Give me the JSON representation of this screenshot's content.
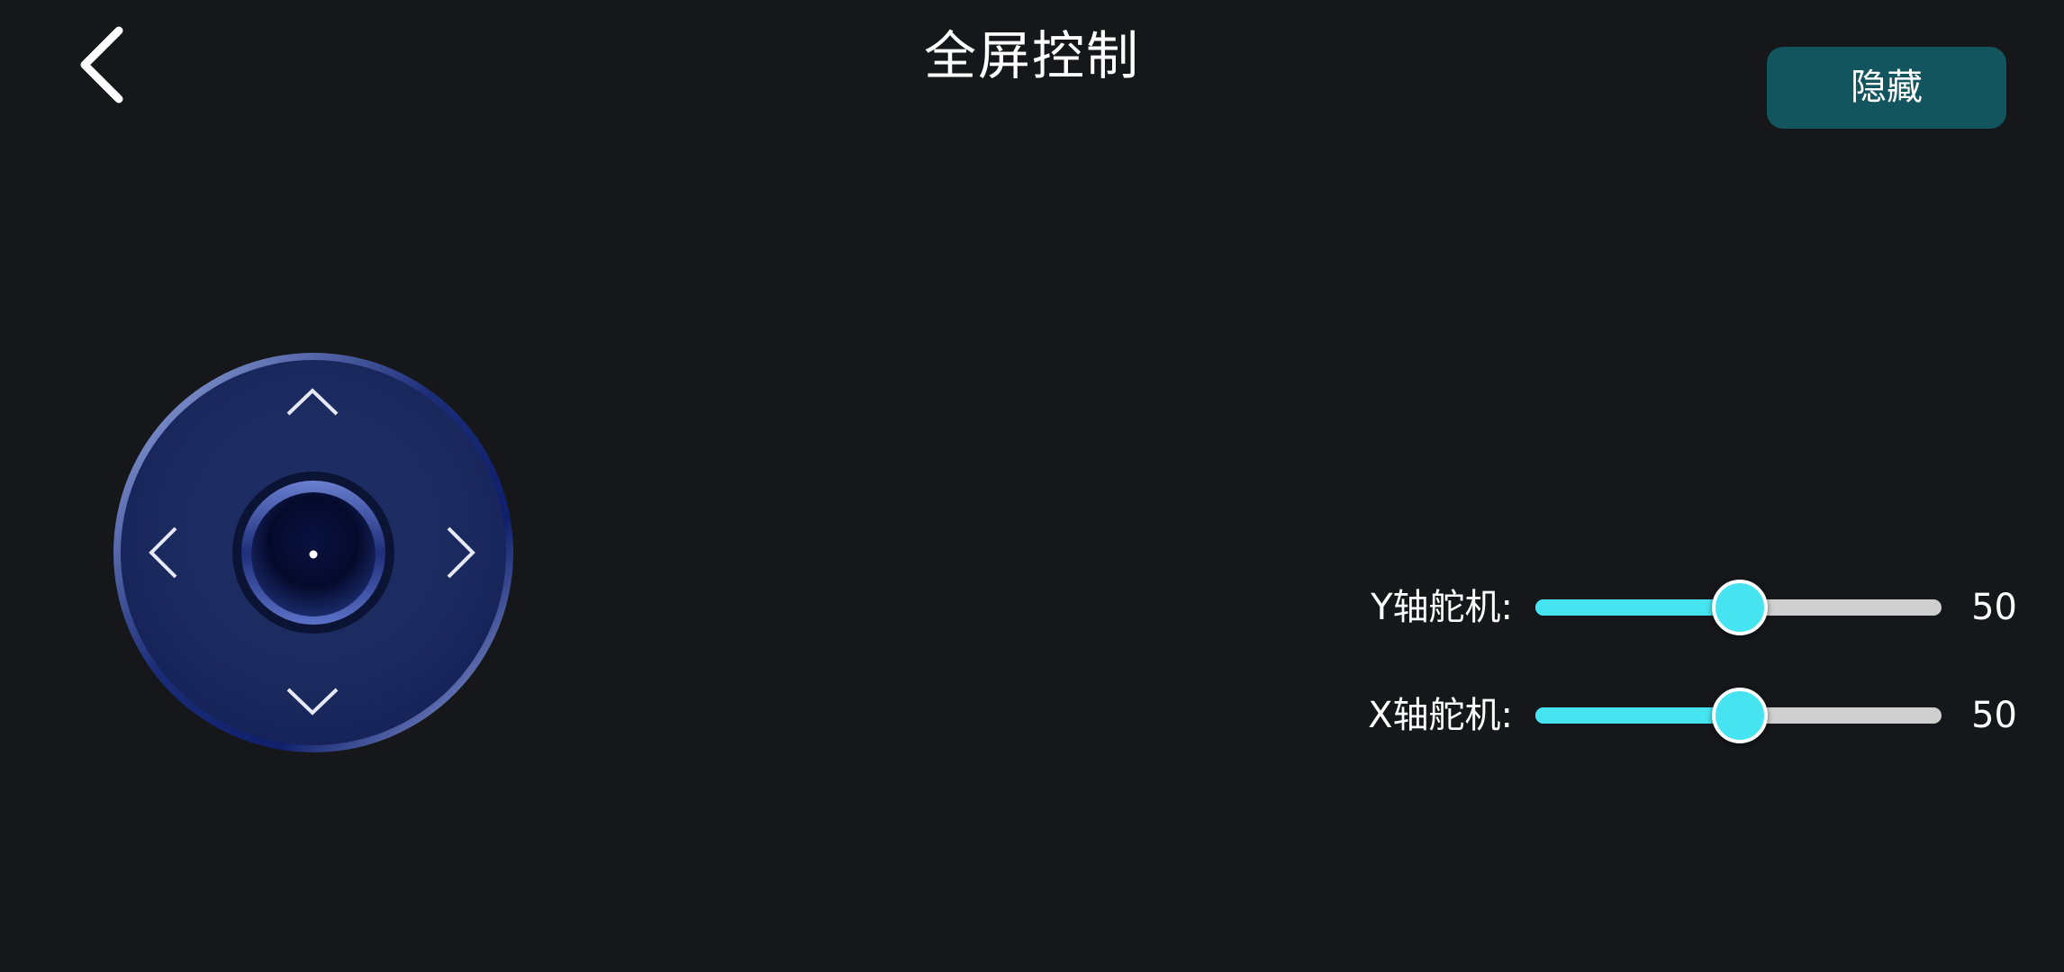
{
  "header": {
    "back_icon": "chevron-left-icon",
    "title": "全屏控制",
    "hide_button_label": "隐藏"
  },
  "joystick": {
    "up_icon": "chevron-up-icon",
    "down_icon": "chevron-down-icon",
    "left_icon": "chevron-left-icon",
    "right_icon": "chevron-right-icon",
    "center_icon": "center-knob"
  },
  "sliders": [
    {
      "label": "Y轴舵机:",
      "value": "50",
      "percent": 50
    },
    {
      "label": "X轴舵机:",
      "value": "50",
      "percent": 50
    }
  ],
  "colors": {
    "background": "#16171a",
    "accent": "#46e3f0",
    "button": "#12555e",
    "track": "#cfcfcf",
    "joystick": "#1b2a5e"
  }
}
